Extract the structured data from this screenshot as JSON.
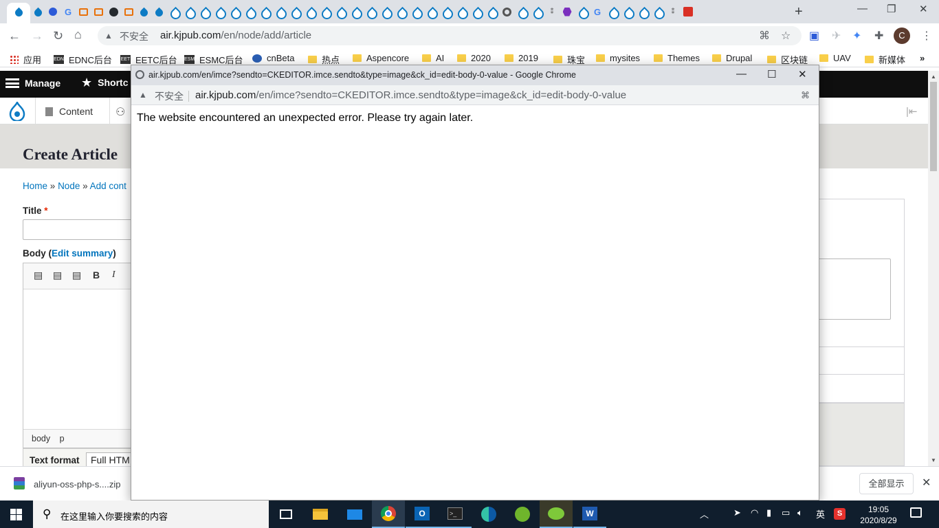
{
  "browser": {
    "address_bar": {
      "security_label": "不安全",
      "url_host": "air.kjpub.com",
      "url_path": "/en/node/add/article"
    },
    "profile_initial": "C",
    "bookmarks": [
      {
        "label": "应用",
        "icon": "apps-grid-icon"
      },
      {
        "label": "EDNC后台",
        "icon": "edn-logo-icon"
      },
      {
        "label": "EETC后台",
        "icon": "eet-logo-icon"
      },
      {
        "label": "ESMC后台",
        "icon": "esm-logo-icon"
      },
      {
        "label": "cnBeta",
        "icon": "cnbeta-icon"
      },
      {
        "label": "热点",
        "icon": "folder-icon"
      },
      {
        "label": "Aspencore",
        "icon": "folder-icon"
      },
      {
        "label": "AI",
        "icon": "folder-icon"
      },
      {
        "label": "2020",
        "icon": "folder-icon"
      },
      {
        "label": "2019",
        "icon": "folder-icon"
      },
      {
        "label": "珠宝",
        "icon": "folder-icon"
      },
      {
        "label": "mysites",
        "icon": "folder-icon"
      },
      {
        "label": "Themes",
        "icon": "folder-icon"
      },
      {
        "label": "Drupal",
        "icon": "folder-icon"
      },
      {
        "label": "区块链",
        "icon": "folder-icon"
      },
      {
        "label": "UAV",
        "icon": "folder-icon"
      },
      {
        "label": "新媒体",
        "icon": "folder-icon"
      }
    ]
  },
  "drupal": {
    "toolbar": {
      "manage_label": "Manage",
      "shortcuts_label": "Shortc"
    },
    "tray": {
      "content_label": "Content"
    },
    "page_title": "Create Article",
    "breadcrumb": {
      "home": "Home",
      "node": "Node",
      "add_content": "Add cont",
      "separator": "»"
    },
    "form": {
      "title_label": "Title",
      "title_required_marker": "*",
      "body_label": "Body",
      "edit_summary": "Edit summary",
      "editor_path": [
        "body",
        "p"
      ],
      "text_format_label": "Text format",
      "text_format_value": "Full HTM"
    }
  },
  "download_bar": {
    "file_name": "aliyun-oss-php-s....zip",
    "show_all_label": "全部显示"
  },
  "popup": {
    "window_title": "air.kjpub.com/en/imce?sendto=CKEDITOR.imce.sendto&type=image&ck_id=edit-body-0-value - Google Chrome",
    "security_label": "不安全",
    "url_host": "air.kjpub.com",
    "url_path": "/en/imce?sendto=CKEDITOR.imce.sendto&type=image&ck_id=edit-body-0-value",
    "error_message": "The website encountered an unexpected error. Please try again later."
  },
  "taskbar": {
    "search_placeholder": "在这里输入你要搜索的内容",
    "ime_label": "英",
    "time": "19:05",
    "date": "2020/8/29"
  }
}
